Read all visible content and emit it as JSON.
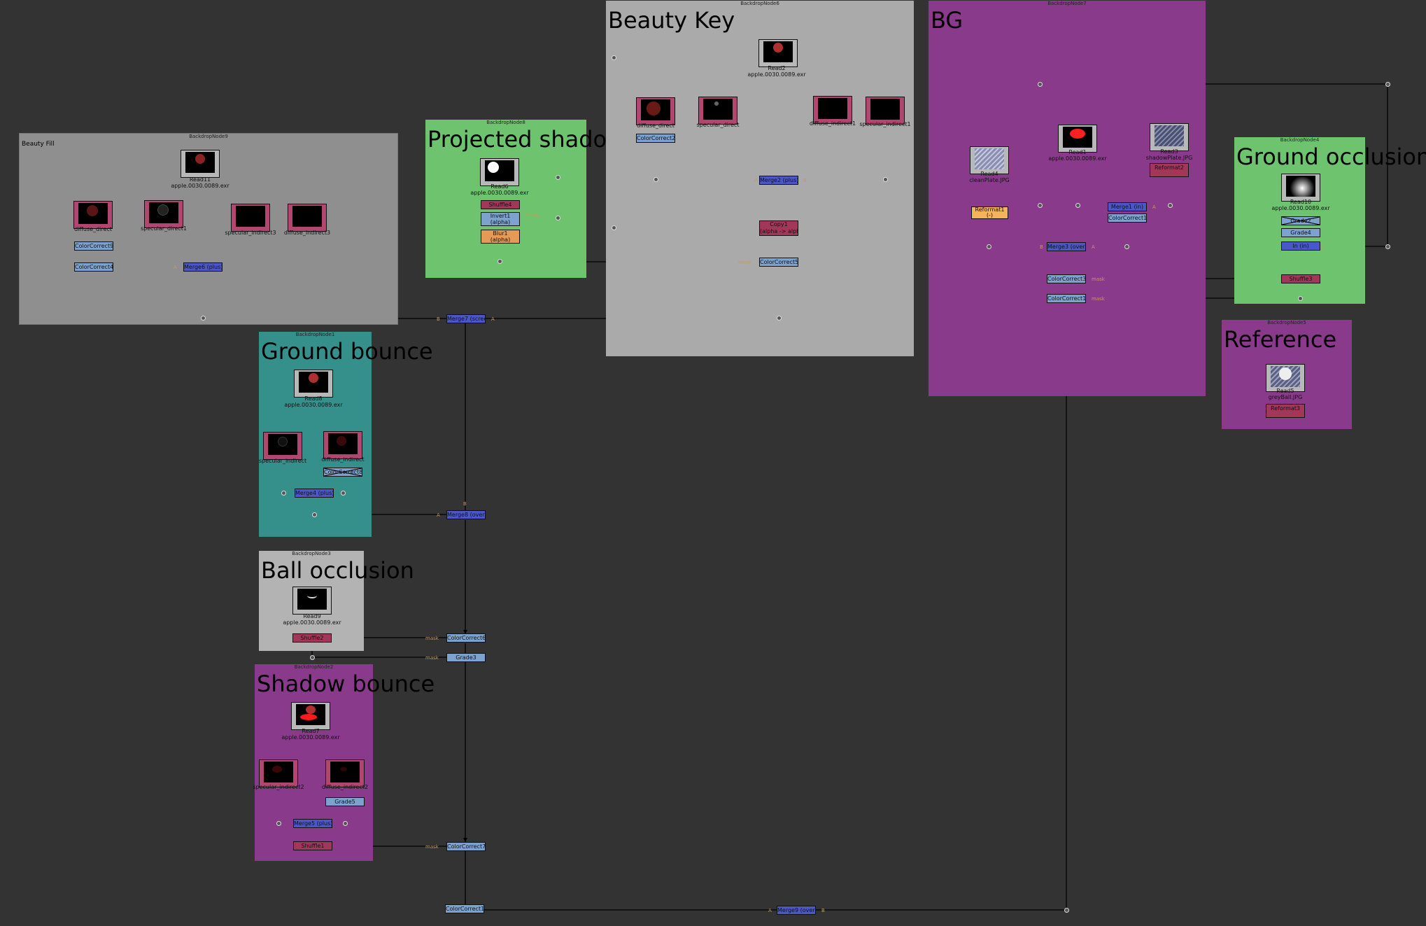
{
  "backdrops": {
    "beauty_fill": {
      "header": "BackdropNode9",
      "label": "Beauty Fill",
      "color": "#8f8f8f"
    },
    "projected_shadow": {
      "header": "BackdropNode8",
      "label": "Projected shadow",
      "color": "#6ec46e"
    },
    "beauty_key": {
      "header": "BackdropNode6",
      "label": "Beauty Key",
      "color": "#aaaaaa"
    },
    "bg": {
      "header": "BackdropNode7",
      "label": "BG",
      "color": "#8a3a8a"
    },
    "ground_occlusion": {
      "header": "BackdropNode4",
      "label": "Ground occlusion",
      "color": "#6ec46e"
    },
    "reference": {
      "header": "BackdropNode5",
      "label": "Reference",
      "color": "#8a3a8a"
    },
    "ground_bounce": {
      "header": "BackdropNode1",
      "label": "Ground bounce",
      "color": "#35908c"
    },
    "ball_occlusion": {
      "header": "BackdropNode3",
      "label": "Ball occlusion",
      "color": "#b3b3b3"
    },
    "shadow_bounce": {
      "header": "BackdropNode2",
      "label": "Shadow bounce",
      "color": "#8a3a8a"
    }
  },
  "reads": {
    "read11": {
      "name": "Read11",
      "file": "apple.0030.0089.exr"
    },
    "diffuse_direct": {
      "name": "diffuse_direct"
    },
    "specular_direct1": {
      "name": "specular_direct1"
    },
    "specular_indirect3": {
      "name": "specular_indirect3"
    },
    "diffuse_indirect3": {
      "name": "diffuse_indirect3"
    },
    "read6": {
      "name": "Read6",
      "file": "apple.0030.0089.exr"
    },
    "read2": {
      "name": "Read2",
      "file": "apple.0030.0089.exr"
    },
    "diffuse_direct_key": {
      "name": "diffuse_direct"
    },
    "specular_direct_key": {
      "name": "specular_direct"
    },
    "diffuse_indirect1": {
      "name": "diffuse_indirect1"
    },
    "specular_indirect1": {
      "name": "specular_indirect1"
    },
    "read4": {
      "name": "Read4",
      "file": "cleanPlate.JPG"
    },
    "read1": {
      "name": "Read1",
      "file": "apple.0030.0089.exr"
    },
    "read3": {
      "name": "Read3",
      "file": "shadowPlate.JPG"
    },
    "read10": {
      "name": "Read10",
      "file": "apple.0030.0089.exr"
    },
    "read5": {
      "name": "Read5",
      "file": "greyBall.JPG"
    },
    "read8": {
      "name": "Read8",
      "file": "apple.0030.0089.exr"
    },
    "specular_indirect": {
      "name": "specular_indirect"
    },
    "diffuse_indirect": {
      "name": "diffuse_indirect"
    },
    "read9": {
      "name": "Read9",
      "file": "apple.0030.0089.exr"
    },
    "read7": {
      "name": "Read7",
      "file": "apple.0030.0089.exr"
    },
    "specular_indirect2": {
      "name": "specular_indirect2"
    },
    "diffuse_indirect2": {
      "name": "diffuse_indirect2"
    }
  },
  "nodes": {
    "cc9": "ColorCorrect9",
    "cc4": "ColorCorrect4",
    "merge6": "Merge6 (plus)",
    "shuffle4": "Shuffle4",
    "invert1": "Invert1",
    "invert1_sub": "(alpha)",
    "blur1": "Blur1",
    "blur1_sub": "(alpha)",
    "cc2": "ColorCorrect2",
    "merge2": "Merge2 (plus)",
    "copy1": "Copy1",
    "copy1_sub": "(alpha -> alpha)",
    "cc5": "ColorCorrect5",
    "merge7": "Merge7 (screen)",
    "reformat1": "Reformat1",
    "reformat1_sub": "(-)",
    "reformat2": "Reformat2",
    "merge1": "Merge1 (in)",
    "cc1": "ColorCorrect1",
    "merge3": "Merge3 (over)",
    "cc3": "ColorCorrect3",
    "cc10": "ColorCorrect10",
    "grade2": "Grade2",
    "grade4": "Grade4",
    "in4": "In (in)",
    "shuffle3": "Shuffle3",
    "reformat3": "Reformat3",
    "merge4": "Merge4 (plus)",
    "cc_disabled": "ColorCorrect8",
    "merge8": "Merge8 (over)",
    "shuffle2": "Shuffle2",
    "cc6": "ColorCorrect6",
    "grade3": "Grade3",
    "grade5": "Grade5",
    "merge5": "Merge5 (plus)",
    "shuffle1": "Shuffle1",
    "cc7": "ColorCorrect7",
    "cc11": "ColorCorrect11",
    "merge_final": "Merge9 (over)"
  },
  "pin_labels": {
    "mask": "mask",
    "A": "A",
    "B": "B",
    "alpha": "alpha"
  }
}
